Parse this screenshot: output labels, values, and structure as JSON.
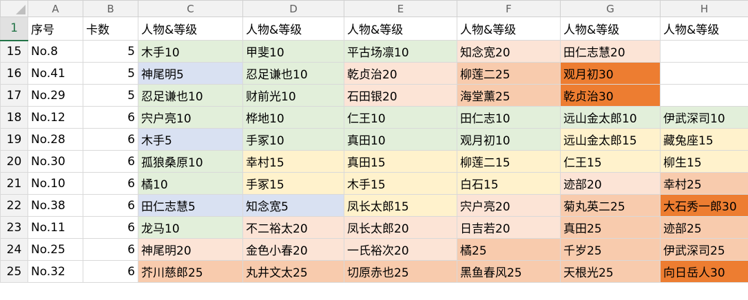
{
  "sheet": {
    "column_letters": [
      "A",
      "B",
      "C",
      "D",
      "E",
      "F",
      "G",
      "H"
    ],
    "header_row": {
      "row_number": "1",
      "cells": [
        "序号",
        "卡数",
        "人物&等级",
        "人物&等级",
        "人物&等级",
        "人物&等级",
        "人物&等级",
        "人物&等级"
      ]
    },
    "colors": {
      "green": "#e2efda",
      "blue": "#d9e1f2",
      "yellow": "#fff2cc",
      "peach": "#fce4d6",
      "salmon": "#f8cbad",
      "orange": "#ed7d31",
      "white": "#ffffff"
    },
    "rows": [
      {
        "row_number": "15",
        "id": "No.8",
        "count": "5",
        "cells": [
          {
            "text": "木手10",
            "color": "green"
          },
          {
            "text": "甲斐10",
            "color": "green"
          },
          {
            "text": "平古场凛10",
            "color": "green"
          },
          {
            "text": "知念宽20",
            "color": "peach"
          },
          {
            "text": "田仁志慧20",
            "color": "peach"
          },
          {
            "text": "",
            "color": "white"
          }
        ]
      },
      {
        "row_number": "16",
        "id": "No.41",
        "count": "5",
        "cells": [
          {
            "text": "神尾明5",
            "color": "blue"
          },
          {
            "text": "忍足谦也10",
            "color": "green"
          },
          {
            "text": "乾贞治20",
            "color": "peach"
          },
          {
            "text": "柳莲二25",
            "color": "salmon"
          },
          {
            "text": "观月初30",
            "color": "orange"
          },
          {
            "text": "",
            "color": "white"
          }
        ]
      },
      {
        "row_number": "17",
        "id": "No.29",
        "count": "5",
        "cells": [
          {
            "text": "忍足谦也10",
            "color": "green"
          },
          {
            "text": "财前光10",
            "color": "green"
          },
          {
            "text": "石田银20",
            "color": "peach"
          },
          {
            "text": "海堂薰25",
            "color": "salmon"
          },
          {
            "text": "乾贞治30",
            "color": "orange"
          },
          {
            "text": "",
            "color": "white"
          }
        ]
      },
      {
        "row_number": "18",
        "id": "No.12",
        "count": "6",
        "cells": [
          {
            "text": "宍户亮10",
            "color": "green"
          },
          {
            "text": "桦地10",
            "color": "green"
          },
          {
            "text": "仁王10",
            "color": "green"
          },
          {
            "text": "田仁志10",
            "color": "green"
          },
          {
            "text": "远山金太郎10",
            "color": "green"
          },
          {
            "text": "伊武深司10",
            "color": "green"
          }
        ]
      },
      {
        "row_number": "19",
        "id": "No.28",
        "count": "6",
        "cells": [
          {
            "text": "木手5",
            "color": "blue"
          },
          {
            "text": "手冢10",
            "color": "green"
          },
          {
            "text": "真田10",
            "color": "green"
          },
          {
            "text": "观月初10",
            "color": "green"
          },
          {
            "text": "远山金太郎15",
            "color": "yellow"
          },
          {
            "text": "藏兔座15",
            "color": "yellow"
          }
        ]
      },
      {
        "row_number": "20",
        "id": "No.30",
        "count": "6",
        "cells": [
          {
            "text": "孤狼桑原10",
            "color": "green"
          },
          {
            "text": "幸村15",
            "color": "yellow"
          },
          {
            "text": "真田15",
            "color": "yellow"
          },
          {
            "text": "柳莲二15",
            "color": "yellow"
          },
          {
            "text": "仁王15",
            "color": "yellow"
          },
          {
            "text": "柳生15",
            "color": "yellow"
          }
        ]
      },
      {
        "row_number": "21",
        "id": "No.10",
        "count": "6",
        "cells": [
          {
            "text": "橘10",
            "color": "green"
          },
          {
            "text": "手冢15",
            "color": "yellow"
          },
          {
            "text": "木手15",
            "color": "yellow"
          },
          {
            "text": "白石15",
            "color": "yellow"
          },
          {
            "text": "迹部20",
            "color": "peach"
          },
          {
            "text": "幸村25",
            "color": "salmon"
          }
        ]
      },
      {
        "row_number": "22",
        "id": "No.38",
        "count": "6",
        "cells": [
          {
            "text": "田仁志慧5",
            "color": "blue"
          },
          {
            "text": "知念宽5",
            "color": "blue"
          },
          {
            "text": "凤长太郎15",
            "color": "yellow"
          },
          {
            "text": "宍户亮20",
            "color": "peach"
          },
          {
            "text": "菊丸英二25",
            "color": "salmon"
          },
          {
            "text": "大石秀一郎30",
            "color": "orange"
          }
        ]
      },
      {
        "row_number": "23",
        "id": "No.11",
        "count": "6",
        "cells": [
          {
            "text": "龙马10",
            "color": "green"
          },
          {
            "text": "不二裕太20",
            "color": "peach"
          },
          {
            "text": "凤长太郎20",
            "color": "peach"
          },
          {
            "text": "日吉若20",
            "color": "peach"
          },
          {
            "text": "真田25",
            "color": "salmon"
          },
          {
            "text": "迹部25",
            "color": "salmon"
          }
        ]
      },
      {
        "row_number": "24",
        "id": "No.25",
        "count": "6",
        "cells": [
          {
            "text": "神尾明20",
            "color": "peach"
          },
          {
            "text": "金色小春20",
            "color": "peach"
          },
          {
            "text": "一氏裕次20",
            "color": "peach"
          },
          {
            "text": "橘25",
            "color": "salmon"
          },
          {
            "text": "千岁25",
            "color": "salmon"
          },
          {
            "text": "伊武深司25",
            "color": "salmon"
          }
        ]
      },
      {
        "row_number": "25",
        "id": "No.32",
        "count": "6",
        "cells": [
          {
            "text": "芥川慈郎25",
            "color": "salmon"
          },
          {
            "text": "丸井文太25",
            "color": "salmon"
          },
          {
            "text": "切原赤也25",
            "color": "salmon"
          },
          {
            "text": "黑鱼春风25",
            "color": "salmon"
          },
          {
            "text": "天根光25",
            "color": "salmon"
          },
          {
            "text": "向日岳人30",
            "color": "orange"
          }
        ]
      }
    ]
  }
}
